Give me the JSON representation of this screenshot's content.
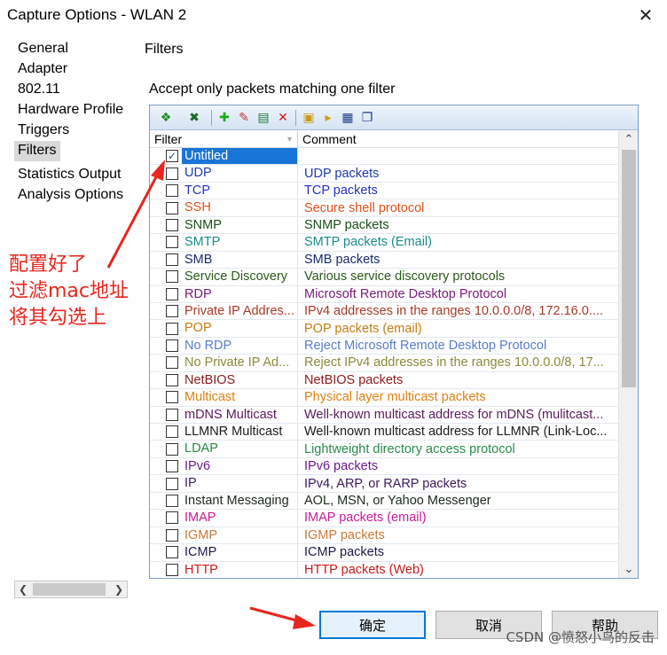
{
  "window": {
    "title": "Capture Options - WLAN 2",
    "close_glyph": "✕"
  },
  "nav": {
    "items": [
      {
        "label": "General"
      },
      {
        "label": "Adapter"
      },
      {
        "label": "802.11"
      },
      {
        "label": "Hardware Profile"
      },
      {
        "label": "Triggers"
      },
      {
        "label": "Filters",
        "selected": true
      },
      {
        "label": "Statistics Output"
      },
      {
        "label": "Analysis Options"
      }
    ]
  },
  "panel": {
    "section_title": "Filters",
    "accept_label": "Accept only packets matching one filter"
  },
  "toolbar": {
    "icons": [
      "select-all-icon",
      "deselect-icon",
      "add-icon",
      "edit-icon",
      "rename-icon",
      "delete-icon",
      "import-icon",
      "export-icon",
      "save-icon",
      "copy-icon"
    ]
  },
  "columns": {
    "filter": "Filter",
    "comment": "Comment"
  },
  "filters": [
    {
      "name": "Untitled",
      "comment": "",
      "checked": true,
      "selected": true,
      "color": "#ffffff"
    },
    {
      "name": "UDP",
      "comment": "UDP packets",
      "color": "#1f3aa8"
    },
    {
      "name": "TCP",
      "comment": "TCP packets",
      "color": "#2230c8"
    },
    {
      "name": "SSH",
      "comment": "Secure shell protocol",
      "color": "#e0501a"
    },
    {
      "name": "SNMP",
      "comment": "SNMP packets",
      "color": "#1a4d1a"
    },
    {
      "name": "SMTP",
      "comment": "SMTP packets (Email)",
      "color": "#1a8a8a"
    },
    {
      "name": "SMB",
      "comment": "SMB packets",
      "color": "#1a2a6a"
    },
    {
      "name": "Service Discovery",
      "comment": "Various service discovery protocols",
      "color": "#2a5a1a"
    },
    {
      "name": "RDP",
      "comment": "Microsoft Remote Desktop Protocol",
      "color": "#7a1a7a"
    },
    {
      "name": "Private IP Addres...",
      "comment": "IPv4 addresses in the ranges 10.0.0.0/8, 172.16.0....",
      "color": "#a83a2a"
    },
    {
      "name": "POP",
      "comment": "POP packets (email)",
      "color": "#c87a10"
    },
    {
      "name": "No RDP",
      "comment": "Reject Microsoft Remote Desktop Protocol",
      "color": "#5a7ac8"
    },
    {
      "name": "No Private IP Ad...",
      "comment": "Reject IPv4 addresses in the ranges 10.0.0.0/8, 17...",
      "color": "#8a8a3a"
    },
    {
      "name": "NetBIOS",
      "comment": "NetBIOS packets",
      "color": "#8a1a1a"
    },
    {
      "name": "Multicast",
      "comment": "Physical layer multicast packets",
      "color": "#e08010"
    },
    {
      "name": "mDNS Multicast",
      "comment": "Well-known multicast address for mDNS (mulitcast...",
      "color": "#5a1a5a"
    },
    {
      "name": "LLMNR Multicast",
      "comment": "Well-known multicast address for LLMNR (Link-Loc...",
      "color": "#1a1a1a"
    },
    {
      "name": "LDAP",
      "comment": "Lightweight directory access protocol",
      "color": "#2a8a4a"
    },
    {
      "name": "IPv6",
      "comment": "IPv6 packets",
      "color": "#6a1a8a"
    },
    {
      "name": "IP",
      "comment": "IPv4, ARP, or RARP packets",
      "color": "#3a1a5a"
    },
    {
      "name": "Instant Messaging",
      "comment": "AOL, MSN, or Yahoo Messenger",
      "color": "#1a2a1a"
    },
    {
      "name": "IMAP",
      "comment": "IMAP packets (email)",
      "color": "#c81a9a"
    },
    {
      "name": "IGMP",
      "comment": "IGMP packets",
      "color": "#c87a3a"
    },
    {
      "name": "ICMP",
      "comment": "ICMP packets",
      "color": "#1a1a4a"
    },
    {
      "name": "HTTP",
      "comment": "HTTP packets (Web)",
      "color": "#c81a1a"
    }
  ],
  "buttons": {
    "ok": "确定",
    "cancel": "取消",
    "help": "帮助"
  },
  "annotation": {
    "lines": [
      "配置好了",
      "过滤mac地址",
      "将其勾选上"
    ],
    "color": "#e8261e"
  },
  "watermark": "CSDN @愤怒小鸟的反击"
}
